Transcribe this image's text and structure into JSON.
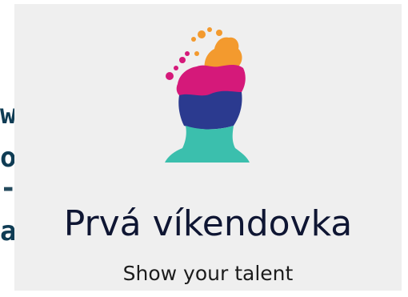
{
  "side_text": {
    "line1": "w",
    "line2": "o",
    "line3": "-",
    "line4": "a"
  },
  "brand": {
    "name": "Prvá víkendovka",
    "tagline": "Show your talent"
  },
  "colors": {
    "background": "#efefef",
    "text": "#0f1633",
    "logo_orange": "#f39a2e",
    "logo_magenta": "#d5197a",
    "logo_navy": "#2b3a8f",
    "logo_teal": "#3bbfad",
    "side_text": "#0f3c54"
  },
  "icons": {
    "logo": "head-silhouette-paint-splash-icon"
  }
}
